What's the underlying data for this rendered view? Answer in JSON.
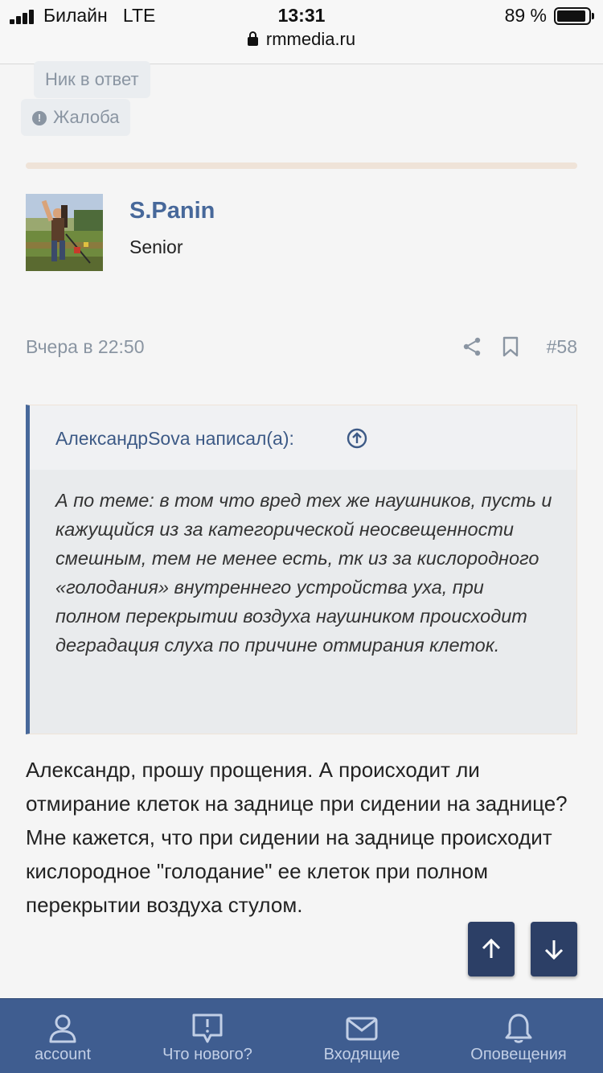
{
  "status_bar": {
    "carrier": "Билайн",
    "network": "LTE",
    "time": "13:31",
    "url": "rmmedia.ru",
    "battery_percent": "89 %"
  },
  "actions": {
    "nick_reply": "Ник в ответ",
    "report": "Жалоба"
  },
  "author": {
    "name": "S.Panin",
    "title": "Senior"
  },
  "post": {
    "date": "Вчера в 22:50",
    "number": "#58",
    "quote_author": "АлександрSova написал(а):",
    "quote_text": "А по теме: в том что вред тех же наушников, пусть и кажущийся из за категорической неосвещенности смешным, тем не менее есть, тк из за кислородного «голодания» внутреннего устройства уха, при полном перекрытии воздуха наушником происходит деградация слуха по причине отмирания клеток.",
    "body_paragraph_1": "Александр, прошу прощения. А происходит ли отмирание клеток на заднице при сидении на заднице?",
    "body_paragraph_2": "Мне кажется, что при сидении на заднице происходит кислородное \"голодание\" ее клеток при полном перекрытии воздуха стулом."
  },
  "tabbar": {
    "items": [
      {
        "label": "account",
        "icon": "person-icon"
      },
      {
        "label": "Что нового?",
        "icon": "speech-bubble-icon"
      },
      {
        "label": "Входящие",
        "icon": "envelope-icon"
      },
      {
        "label": "Оповещения",
        "icon": "bell-icon"
      }
    ]
  },
  "colors": {
    "accent": "#47689a",
    "tabbar": "#3f5d90",
    "fab": "#2c3f66",
    "muted_text": "#8a95a2",
    "divider": "#efe3d8"
  }
}
